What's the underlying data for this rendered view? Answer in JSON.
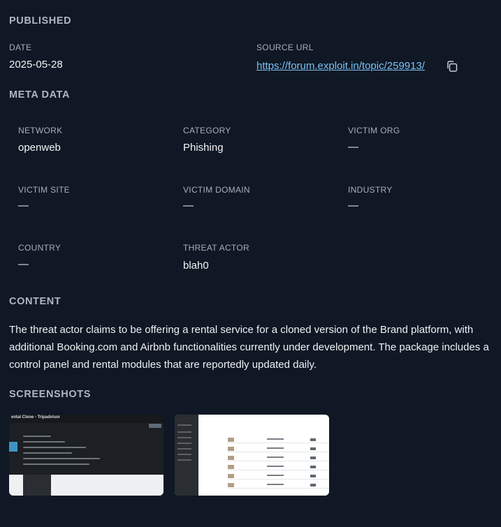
{
  "published": {
    "title": "PUBLISHED",
    "date_label": "DATE",
    "date_value": "2025-05-28",
    "source_label": "SOURCE URL",
    "source_url": "https://forum.exploit.in/topic/259913/"
  },
  "meta": {
    "title": "META DATA",
    "network_label": "NETWORK",
    "network_value": "openweb",
    "category_label": "CATEGORY",
    "category_value": "Phishing",
    "victim_org_label": "VICTIM ORG",
    "victim_org_value": "—",
    "victim_site_label": "VICTIM SITE",
    "victim_site_value": "—",
    "victim_domain_label": "VICTIM DOMAIN",
    "victim_domain_value": "—",
    "industry_label": "INDUSTRY",
    "industry_value": "—",
    "country_label": "COUNTRY",
    "country_value": "—",
    "threat_actor_label": "THREAT ACTOR",
    "threat_actor_value": "blah0"
  },
  "content": {
    "title": "CONTENT",
    "text": "The threat actor claims to be offering a rental service for a cloned version of the Brand platform, with additional Booking.com and Airbnb functionalities currently under development. The package includes a control panel and rental modules that are reportedly updated daily."
  },
  "screenshots": {
    "title": "SCREENSHOTS",
    "first_caption": "ental Clone - Tripadvisor"
  },
  "icons": {
    "copy": "copy-icon"
  },
  "colors": {
    "background": "#0f1824",
    "link": "#7cc0f5",
    "label": "#a7afbb"
  }
}
